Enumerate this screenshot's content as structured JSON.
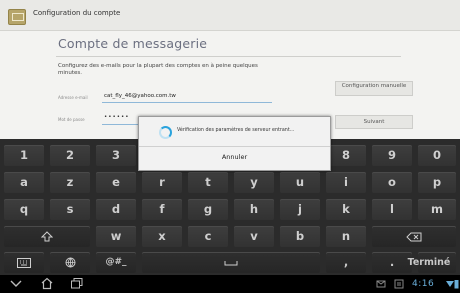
{
  "titlebar": {
    "title": "Configuration du compte"
  },
  "page": {
    "heading": "Compte de messagerie",
    "description": "Configurez des e-mails pour la plupart des comptes en à peine quelques minutes."
  },
  "form": {
    "email_label": "Adresse e-mail",
    "email_value": "cat_fly_46@yahoo.com.tw",
    "password_label": "Mot de passe",
    "password_value": "••••••"
  },
  "buttons": {
    "manual": "Configuration manuelle",
    "next": "Suivant"
  },
  "dialog": {
    "message": "Vérification des paramètres de serveur entrant...",
    "cancel": "Annuler"
  },
  "keyboard": {
    "row1": [
      "1",
      "2",
      "3",
      "4",
      "5",
      "6",
      "7",
      "8",
      "9",
      "0"
    ],
    "row2": [
      "a",
      "z",
      "e",
      "r",
      "t",
      "y",
      "u",
      "i",
      "o",
      "p"
    ],
    "row3": [
      "q",
      "s",
      "d",
      "f",
      "g",
      "h",
      "j",
      "k",
      "l",
      "m"
    ],
    "row4": [
      "w",
      "x",
      "c",
      "v",
      "b",
      "n"
    ],
    "symbols_label": "@#_",
    "comma": ",",
    "period": ".",
    "done_label": "Terminé"
  },
  "statusbar": {
    "clock": "4:16"
  }
}
